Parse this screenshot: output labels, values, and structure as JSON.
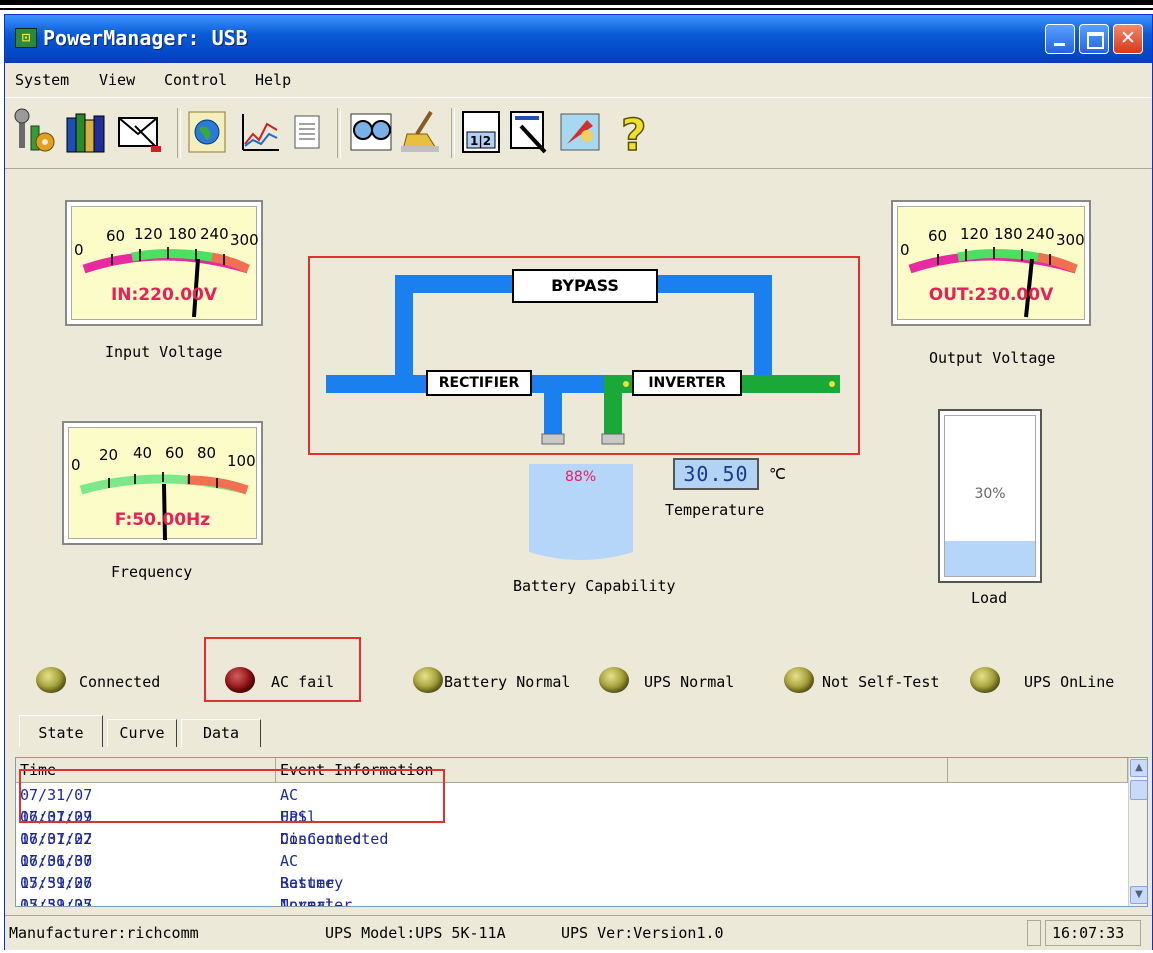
{
  "window": {
    "title": "PowerManager: USB",
    "icon": "app-icon"
  },
  "menu": [
    "System",
    "View",
    "Control",
    "Help"
  ],
  "toolbar_icons": [
    "settings-tools-icon",
    "books-icon",
    "message-icon",
    "globe-icon",
    "chart-icon",
    "list-icon",
    "glasses-icon",
    "broom-icon",
    "calendar-icon",
    "hammer-icon",
    "wizard-icon",
    "help-icon"
  ],
  "meters": {
    "input": {
      "scale": [
        "0",
        "60",
        "120",
        "180",
        "240",
        "300"
      ],
      "readout": "IN:220.00V",
      "label": "Input Voltage",
      "value": 220
    },
    "output": {
      "scale": [
        "0",
        "60",
        "120",
        "180",
        "240",
        "300"
      ],
      "readout": "OUT:230.00V",
      "label": "Output Voltage",
      "value": 230
    },
    "frequency": {
      "scale": [
        "0",
        "20",
        "40",
        "60",
        "80",
        "100"
      ],
      "readout": "F:50.00Hz",
      "label": "Frequency",
      "value": 50
    }
  },
  "diagram": {
    "bypass": "BYPASS",
    "rectifier": "RECTIFIER",
    "inverter": "INVERTER"
  },
  "battery": {
    "percent": "88%",
    "label": "Battery Capability",
    "level": 0.88
  },
  "temperature": {
    "value": "30.50",
    "unit": "℃",
    "label": "Temperature"
  },
  "load": {
    "percent": "30%",
    "label": "Load",
    "level": 0.3
  },
  "indicators": [
    {
      "label": "Connected",
      "color": "olive"
    },
    {
      "label": "AC fail",
      "color": "red"
    },
    {
      "label": "Battery Normal",
      "color": "olive"
    },
    {
      "label": "UPS Normal",
      "color": "olive"
    },
    {
      "label": "Not Self-Test",
      "color": "olive"
    },
    {
      "label": "UPS OnLine",
      "color": "olive"
    }
  ],
  "tabs": [
    "State",
    "Curve",
    "Data"
  ],
  "log": {
    "columns": [
      "Time",
      "Event Information"
    ],
    "rows": [
      {
        "time": "07/31/07 16:07:29",
        "event": "AC Fail"
      },
      {
        "time": "07/31/07 16:07:22",
        "event": "UPS Connected"
      },
      {
        "time": "07/31/07 16:06:30",
        "event": "DisConnected"
      },
      {
        "time": "07/31/07 15:59:26",
        "event": "AC Resume"
      },
      {
        "time": "07/31/07 15:59:25",
        "event": "Battery Normal"
      },
      {
        "time": "07/31/07 15:59:25",
        "event": "Inverter Normal"
      }
    ]
  },
  "status": {
    "manufacturer": "Manufacturer:richcomm",
    "model": "UPS Model:UPS 5K-11A",
    "version": "UPS Ver:Version1.0",
    "time": "16:07:33"
  },
  "colors": {
    "title_blue": "#0a5ad6",
    "readout": "#e8205a",
    "path_blue": "#1a80f0",
    "path_green": "#1aa838",
    "highlight_red": "#e03030"
  }
}
